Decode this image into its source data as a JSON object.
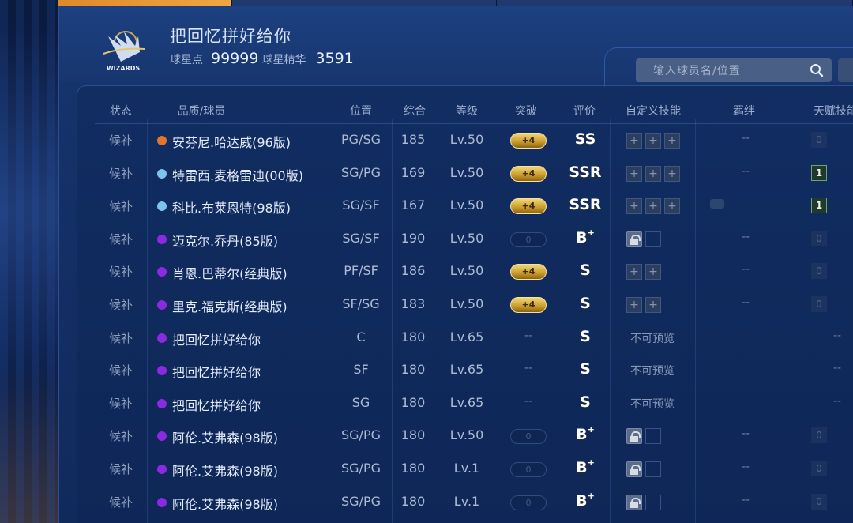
{
  "header": {
    "team_name": "把回忆拼好给你",
    "logo_text": "WIZARDS",
    "stat1_label": "球星点",
    "stat1_value": "99999",
    "stat2_label": "球星精华",
    "stat2_value": "3591"
  },
  "search": {
    "placeholder": "输入球员名/位置"
  },
  "columns": [
    "状态",
    "品质/球员",
    "位置",
    "综合",
    "等级",
    "突破",
    "评价",
    "自定义技能",
    "羁绊",
    "天赋技能"
  ],
  "colors": {
    "orange": "#e2772a",
    "lightblue": "#7cc4ec",
    "purple": "#8a2be2",
    "accent_tab": "#e8962f"
  },
  "rows": [
    {
      "status": "候补",
      "quality": "orange",
      "name": "安芬尼.哈达威(96版)",
      "position": "PG/SG",
      "overall": "185",
      "level": "Lv.50",
      "breakthrough": "+4",
      "break_type": "gold",
      "grade": "SS",
      "grade_sup": "",
      "skills": [
        "+",
        "+",
        "+"
      ],
      "skill_type": "slots",
      "bond": "--",
      "talent": "0",
      "talent_type": "zero"
    },
    {
      "status": "候补",
      "quality": "lightblue",
      "name": "特雷西.麦格雷迪(00版)",
      "position": "SG/PG",
      "overall": "169",
      "level": "Lv.50",
      "breakthrough": "+4",
      "break_type": "gold",
      "grade": "SSR",
      "grade_sup": "",
      "skills": [
        "+",
        "+",
        "+"
      ],
      "skill_type": "slots",
      "bond": "--",
      "talent": "1",
      "talent_type": "badge"
    },
    {
      "status": "候补",
      "quality": "lightblue",
      "name": "科比.布莱恩特(98版)",
      "position": "SG/SF",
      "overall": "167",
      "level": "Lv.50",
      "breakthrough": "+4",
      "break_type": "gold",
      "grade": "SSR",
      "grade_sup": "",
      "skills": [
        "+",
        "+",
        "+"
      ],
      "skill_type": "slots",
      "bond": "icon",
      "talent": "1",
      "talent_type": "badge"
    },
    {
      "status": "候补",
      "quality": "purple",
      "name": "迈克尔.乔丹(85版)",
      "position": "SG/SF",
      "overall": "190",
      "level": "Lv.50",
      "breakthrough": "0",
      "break_type": "empty",
      "grade": "B",
      "grade_sup": "+",
      "skills": [],
      "skill_type": "lock",
      "bond": "--",
      "talent": "0",
      "talent_type": "zero"
    },
    {
      "status": "候补",
      "quality": "purple",
      "name": "肖恩.巴蒂尔(经典版)",
      "position": "PF/SF",
      "overall": "186",
      "level": "Lv.50",
      "breakthrough": "+4",
      "break_type": "gold",
      "grade": "S",
      "grade_sup": "",
      "skills": [
        "+",
        "+"
      ],
      "skill_type": "slots",
      "bond": "--",
      "talent": "0",
      "talent_type": "zero"
    },
    {
      "status": "候补",
      "quality": "purple",
      "name": "里克.福克斯(经典版)",
      "position": "SF/SG",
      "overall": "183",
      "level": "Lv.50",
      "breakthrough": "+4",
      "break_type": "gold",
      "grade": "S",
      "grade_sup": "",
      "skills": [
        "+",
        "+"
      ],
      "skill_type": "slots",
      "bond": "--",
      "talent": "0",
      "talent_type": "zero"
    },
    {
      "status": "候补",
      "quality": "purple",
      "name": "把回忆拼好给你",
      "position": "C",
      "overall": "180",
      "level": "Lv.65",
      "breakthrough": "--",
      "break_type": "dash",
      "grade": "S",
      "grade_sup": "",
      "skills": [],
      "skill_type": "preview",
      "preview_text": "不可预览",
      "bond": "",
      "talent": "--",
      "talent_type": "dash"
    },
    {
      "status": "候补",
      "quality": "purple",
      "name": "把回忆拼好给你",
      "position": "SF",
      "overall": "180",
      "level": "Lv.65",
      "breakthrough": "--",
      "break_type": "dash",
      "grade": "S",
      "grade_sup": "",
      "skills": [],
      "skill_type": "preview",
      "preview_text": "不可预览",
      "bond": "",
      "talent": "--",
      "talent_type": "dash"
    },
    {
      "status": "候补",
      "quality": "purple",
      "name": "把回忆拼好给你",
      "position": "SG",
      "overall": "180",
      "level": "Lv.65",
      "breakthrough": "--",
      "break_type": "dash",
      "grade": "S",
      "grade_sup": "",
      "skills": [],
      "skill_type": "preview",
      "preview_text": "不可预览",
      "bond": "",
      "talent": "--",
      "talent_type": "dash"
    },
    {
      "status": "候补",
      "quality": "purple",
      "name": "阿伦.艾弗森(98版)",
      "position": "SG/PG",
      "overall": "180",
      "level": "Lv.50",
      "breakthrough": "0",
      "break_type": "empty",
      "grade": "B",
      "grade_sup": "+",
      "skills": [],
      "skill_type": "lock",
      "bond": "--",
      "talent": "0",
      "talent_type": "zero"
    },
    {
      "status": "候补",
      "quality": "purple",
      "name": "阿伦.艾弗森(98版)",
      "position": "SG/PG",
      "overall": "180",
      "level": "Lv.1",
      "breakthrough": "0",
      "break_type": "empty",
      "grade": "B",
      "grade_sup": "+",
      "skills": [],
      "skill_type": "lock",
      "bond": "--",
      "talent": "0",
      "talent_type": "zero"
    },
    {
      "status": "候补",
      "quality": "purple",
      "name": "阿伦.艾弗森(98版)",
      "position": "SG/PG",
      "overall": "180",
      "level": "Lv.1",
      "breakthrough": "0",
      "break_type": "empty",
      "grade": "B",
      "grade_sup": "+",
      "skills": [],
      "skill_type": "lock",
      "bond": "--",
      "talent": "0",
      "talent_type": "zero"
    }
  ]
}
